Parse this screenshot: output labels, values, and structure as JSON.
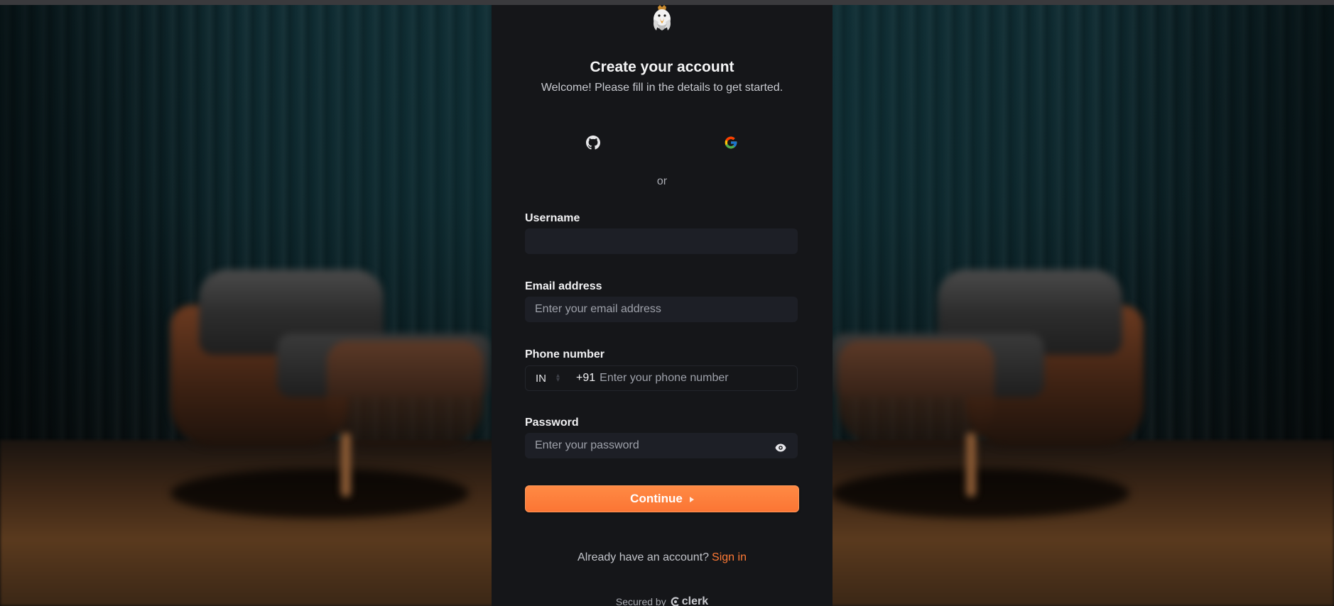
{
  "auth": {
    "title": "Create your account",
    "subtitle": "Welcome! Please fill in the details to get started.",
    "social": [
      {
        "provider": "github",
        "icon": "github-icon"
      },
      {
        "provider": "google",
        "icon": "google-icon"
      }
    ],
    "divider_text": "or",
    "fields": {
      "username": {
        "label": "Username",
        "value": "",
        "placeholder": ""
      },
      "email": {
        "label": "Email address",
        "value": "",
        "placeholder": "Enter your email address"
      },
      "phone": {
        "label": "Phone number",
        "country": "IN",
        "dial_code": "+91",
        "value": "",
        "placeholder": "Enter your phone number"
      },
      "password": {
        "label": "Password",
        "value": "",
        "placeholder": "Enter your password",
        "toggle_icon": "eye-icon"
      }
    },
    "continue_label": "Continue",
    "footer": {
      "prompt": "Already have an account?",
      "link": "Sign in"
    },
    "secured_by": "Secured by",
    "secured_brand": "clerk"
  },
  "colors": {
    "accent": "#fb7534",
    "card_bg": "#151619",
    "input_bg": "#1d1f26",
    "link": "#ff7a35"
  }
}
